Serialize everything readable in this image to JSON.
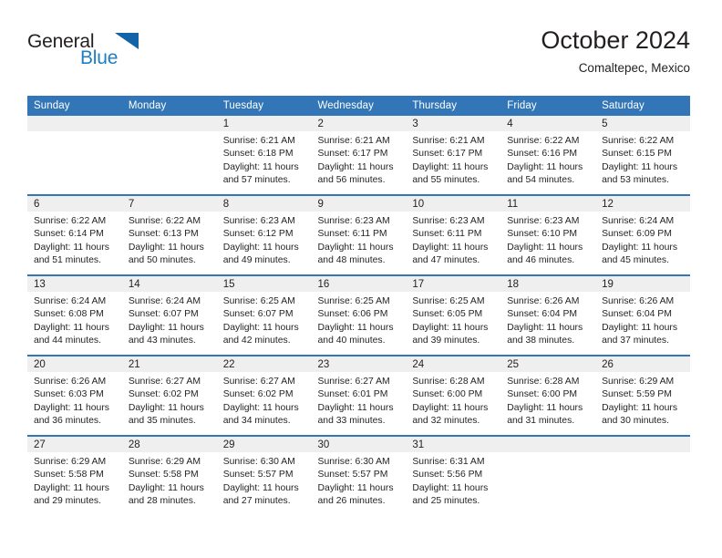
{
  "brand": {
    "name_part1": "General",
    "name_part2": "Blue",
    "triangle_color": "#1263a8",
    "blue_color": "#1f7fc4"
  },
  "header": {
    "title": "October 2024",
    "subtitle": "Comaltepec, Mexico"
  },
  "theme": {
    "header_bg": "#3276b8",
    "daynum_band_bg": "#efefef",
    "text_color": "#231f20"
  },
  "calendar": {
    "weekday_headers": [
      "Sunday",
      "Monday",
      "Tuesday",
      "Wednesday",
      "Thursday",
      "Friday",
      "Saturday"
    ],
    "weeks": [
      [
        {
          "day": "",
          "sunrise": "",
          "sunset": "",
          "daylight": "",
          "empty": true
        },
        {
          "day": "",
          "sunrise": "",
          "sunset": "",
          "daylight": "",
          "empty": true
        },
        {
          "day": "1",
          "sunrise": "Sunrise: 6:21 AM",
          "sunset": "Sunset: 6:18 PM",
          "daylight": "Daylight: 11 hours and 57 minutes."
        },
        {
          "day": "2",
          "sunrise": "Sunrise: 6:21 AM",
          "sunset": "Sunset: 6:17 PM",
          "daylight": "Daylight: 11 hours and 56 minutes."
        },
        {
          "day": "3",
          "sunrise": "Sunrise: 6:21 AM",
          "sunset": "Sunset: 6:17 PM",
          "daylight": "Daylight: 11 hours and 55 minutes."
        },
        {
          "day": "4",
          "sunrise": "Sunrise: 6:22 AM",
          "sunset": "Sunset: 6:16 PM",
          "daylight": "Daylight: 11 hours and 54 minutes."
        },
        {
          "day": "5",
          "sunrise": "Sunrise: 6:22 AM",
          "sunset": "Sunset: 6:15 PM",
          "daylight": "Daylight: 11 hours and 53 minutes."
        }
      ],
      [
        {
          "day": "6",
          "sunrise": "Sunrise: 6:22 AM",
          "sunset": "Sunset: 6:14 PM",
          "daylight": "Daylight: 11 hours and 51 minutes."
        },
        {
          "day": "7",
          "sunrise": "Sunrise: 6:22 AM",
          "sunset": "Sunset: 6:13 PM",
          "daylight": "Daylight: 11 hours and 50 minutes."
        },
        {
          "day": "8",
          "sunrise": "Sunrise: 6:23 AM",
          "sunset": "Sunset: 6:12 PM",
          "daylight": "Daylight: 11 hours and 49 minutes."
        },
        {
          "day": "9",
          "sunrise": "Sunrise: 6:23 AM",
          "sunset": "Sunset: 6:11 PM",
          "daylight": "Daylight: 11 hours and 48 minutes."
        },
        {
          "day": "10",
          "sunrise": "Sunrise: 6:23 AM",
          "sunset": "Sunset: 6:11 PM",
          "daylight": "Daylight: 11 hours and 47 minutes."
        },
        {
          "day": "11",
          "sunrise": "Sunrise: 6:23 AM",
          "sunset": "Sunset: 6:10 PM",
          "daylight": "Daylight: 11 hours and 46 minutes."
        },
        {
          "day": "12",
          "sunrise": "Sunrise: 6:24 AM",
          "sunset": "Sunset: 6:09 PM",
          "daylight": "Daylight: 11 hours and 45 minutes."
        }
      ],
      [
        {
          "day": "13",
          "sunrise": "Sunrise: 6:24 AM",
          "sunset": "Sunset: 6:08 PM",
          "daylight": "Daylight: 11 hours and 44 minutes."
        },
        {
          "day": "14",
          "sunrise": "Sunrise: 6:24 AM",
          "sunset": "Sunset: 6:07 PM",
          "daylight": "Daylight: 11 hours and 43 minutes."
        },
        {
          "day": "15",
          "sunrise": "Sunrise: 6:25 AM",
          "sunset": "Sunset: 6:07 PM",
          "daylight": "Daylight: 11 hours and 42 minutes."
        },
        {
          "day": "16",
          "sunrise": "Sunrise: 6:25 AM",
          "sunset": "Sunset: 6:06 PM",
          "daylight": "Daylight: 11 hours and 40 minutes."
        },
        {
          "day": "17",
          "sunrise": "Sunrise: 6:25 AM",
          "sunset": "Sunset: 6:05 PM",
          "daylight": "Daylight: 11 hours and 39 minutes."
        },
        {
          "day": "18",
          "sunrise": "Sunrise: 6:26 AM",
          "sunset": "Sunset: 6:04 PM",
          "daylight": "Daylight: 11 hours and 38 minutes."
        },
        {
          "day": "19",
          "sunrise": "Sunrise: 6:26 AM",
          "sunset": "Sunset: 6:04 PM",
          "daylight": "Daylight: 11 hours and 37 minutes."
        }
      ],
      [
        {
          "day": "20",
          "sunrise": "Sunrise: 6:26 AM",
          "sunset": "Sunset: 6:03 PM",
          "daylight": "Daylight: 11 hours and 36 minutes."
        },
        {
          "day": "21",
          "sunrise": "Sunrise: 6:27 AM",
          "sunset": "Sunset: 6:02 PM",
          "daylight": "Daylight: 11 hours and 35 minutes."
        },
        {
          "day": "22",
          "sunrise": "Sunrise: 6:27 AM",
          "sunset": "Sunset: 6:02 PM",
          "daylight": "Daylight: 11 hours and 34 minutes."
        },
        {
          "day": "23",
          "sunrise": "Sunrise: 6:27 AM",
          "sunset": "Sunset: 6:01 PM",
          "daylight": "Daylight: 11 hours and 33 minutes."
        },
        {
          "day": "24",
          "sunrise": "Sunrise: 6:28 AM",
          "sunset": "Sunset: 6:00 PM",
          "daylight": "Daylight: 11 hours and 32 minutes."
        },
        {
          "day": "25",
          "sunrise": "Sunrise: 6:28 AM",
          "sunset": "Sunset: 6:00 PM",
          "daylight": "Daylight: 11 hours and 31 minutes."
        },
        {
          "day": "26",
          "sunrise": "Sunrise: 6:29 AM",
          "sunset": "Sunset: 5:59 PM",
          "daylight": "Daylight: 11 hours and 30 minutes."
        }
      ],
      [
        {
          "day": "27",
          "sunrise": "Sunrise: 6:29 AM",
          "sunset": "Sunset: 5:58 PM",
          "daylight": "Daylight: 11 hours and 29 minutes."
        },
        {
          "day": "28",
          "sunrise": "Sunrise: 6:29 AM",
          "sunset": "Sunset: 5:58 PM",
          "daylight": "Daylight: 11 hours and 28 minutes."
        },
        {
          "day": "29",
          "sunrise": "Sunrise: 6:30 AM",
          "sunset": "Sunset: 5:57 PM",
          "daylight": "Daylight: 11 hours and 27 minutes."
        },
        {
          "day": "30",
          "sunrise": "Sunrise: 6:30 AM",
          "sunset": "Sunset: 5:57 PM",
          "daylight": "Daylight: 11 hours and 26 minutes."
        },
        {
          "day": "31",
          "sunrise": "Sunrise: 6:31 AM",
          "sunset": "Sunset: 5:56 PM",
          "daylight": "Daylight: 11 hours and 25 minutes."
        },
        {
          "day": "",
          "sunrise": "",
          "sunset": "",
          "daylight": "",
          "empty": true
        },
        {
          "day": "",
          "sunrise": "",
          "sunset": "",
          "daylight": "",
          "empty": true
        }
      ]
    ]
  }
}
